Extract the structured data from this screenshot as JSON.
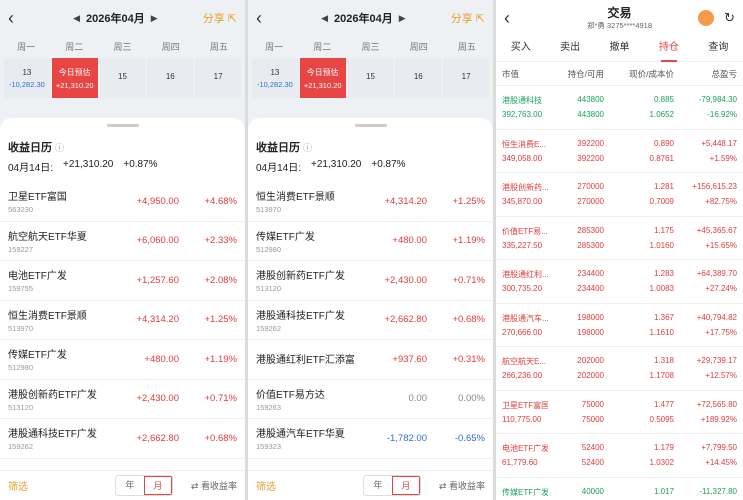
{
  "calendar": {
    "month": "2026年04月",
    "share_label": "分享",
    "weekdays": [
      "周一",
      "周二",
      "周三",
      "周四",
      "周五"
    ],
    "days": [
      {
        "label": "13",
        "pnl": "-10,282.30"
      },
      {
        "label": "今日预估",
        "pnl": "+21,310.20"
      },
      {
        "label": "15",
        "pnl": ""
      },
      {
        "label": "16",
        "pnl": ""
      },
      {
        "label": "17",
        "pnl": ""
      }
    ],
    "section_title": "收益日历",
    "summary_date": "04月14日:",
    "summary_pnl": "+21,310.20",
    "summary_pct": "+0.87%",
    "filter_label": "筛选",
    "segment_year": "年",
    "segment_month": "月",
    "rate_toggle": "看收益率"
  },
  "list_left": [
    {
      "name": "卫星ETF富国",
      "code": "563230",
      "pnl": "+4,950.00",
      "pct": "+4.68%"
    },
    {
      "name": "航空航天ETF华夏",
      "code": "159227",
      "pnl": "+6,060.00",
      "pct": "+2.33%"
    },
    {
      "name": "电池ETF广发",
      "code": "159755",
      "pnl": "+1,257.60",
      "pct": "+2.08%"
    },
    {
      "name": "恒生消费ETF景顺",
      "code": "513970",
      "pnl": "+4,314.20",
      "pct": "+1.25%"
    },
    {
      "name": "传媒ETF广发",
      "code": "512980",
      "pnl": "+480.00",
      "pct": "+1.19%"
    },
    {
      "name": "港股创新药ETF广发",
      "code": "513120",
      "pnl": "+2,430.00",
      "pct": "+0.71%"
    },
    {
      "name": "港股通科技ETF广发",
      "code": "159262",
      "pnl": "+2,662.80",
      "pct": "+0.68%"
    }
  ],
  "list_mid": [
    {
      "name": "恒生消费ETF景顺",
      "code": "513970",
      "pnl": "+4,314.20",
      "pct": "+1.25%",
      "tone": "red"
    },
    {
      "name": "传媒ETF广发",
      "code": "512980",
      "pnl": "+480.00",
      "pct": "+1.19%",
      "tone": "red"
    },
    {
      "name": "港股创新药ETF广发",
      "code": "513120",
      "pnl": "+2,430.00",
      "pct": "+0.71%",
      "tone": "red"
    },
    {
      "name": "港股通科技ETF广发",
      "code": "159262",
      "pnl": "+2,662.80",
      "pct": "+0.68%",
      "tone": "red"
    },
    {
      "name": "港股通红利ETF汇添富",
      "code": "",
      "pnl": "+937.60",
      "pct": "+0.31%",
      "tone": "red"
    },
    {
      "name": "价值ETF易方达",
      "code": "159263",
      "pnl": "0.00",
      "pct": "0.00%",
      "tone": "gray"
    },
    {
      "name": "港股通汽车ETF华夏",
      "code": "159323",
      "pnl": "-1,782.00",
      "pct": "-0.65%",
      "tone": "blue"
    }
  ],
  "trade": {
    "title": "交易",
    "account": "郑*勇 3275****4918",
    "tabs": [
      "买入",
      "卖出",
      "撤单",
      "持仓",
      "查询"
    ],
    "active_tab": 3,
    "headers": [
      "市值",
      "持仓/可用",
      "现价/成本价",
      "总盈亏"
    ],
    "holdings": [
      {
        "name": "港股通科技",
        "mv": "392,763.00",
        "pos": "443800",
        "avail": "443800",
        "price": "0.885",
        "cost": "1.0652",
        "pnl": "-79,984.30",
        "pct": "-16.92%",
        "tone": "green"
      },
      {
        "name": "恒生消费E...",
        "mv": "349,058.00",
        "pos": "392200",
        "avail": "392200",
        "price": "0.890",
        "cost": "0.8761",
        "pnl": "+5,448.17",
        "pct": "+1.59%",
        "tone": "red"
      },
      {
        "name": "港股创新药...",
        "mv": "345,870.00",
        "pos": "270000",
        "avail": "270000",
        "price": "1.281",
        "cost": "0.7009",
        "pnl": "+156,615.23",
        "pct": "+82.75%",
        "tone": "red"
      },
      {
        "name": "价值ETF易...",
        "mv": "335,227.50",
        "pos": "285300",
        "avail": "285300",
        "price": "1.175",
        "cost": "1.0160",
        "pnl": "+45,365.67",
        "pct": "+15.65%",
        "tone": "red"
      },
      {
        "name": "港股通红利...",
        "mv": "300,735.20",
        "pos": "234400",
        "avail": "234400",
        "price": "1.283",
        "cost": "1.0083",
        "pnl": "+64,389.70",
        "pct": "+27.24%",
        "tone": "red"
      },
      {
        "name": "港股通汽车...",
        "mv": "270,666.00",
        "pos": "198000",
        "avail": "198000",
        "price": "1.367",
        "cost": "1.1610",
        "pnl": "+40,794.82",
        "pct": "+17.75%",
        "tone": "red"
      },
      {
        "name": "航空航天E...",
        "mv": "266,236.00",
        "pos": "202000",
        "avail": "202000",
        "price": "1.318",
        "cost": "1.1708",
        "pnl": "+29,739.17",
        "pct": "+12.57%",
        "tone": "red"
      },
      {
        "name": "卫星ETF富国",
        "mv": "110,775.00",
        "pos": "75000",
        "avail": "75000",
        "price": "1.477",
        "cost": "0.5095",
        "pnl": "+72,565.80",
        "pct": "+189.92%",
        "tone": "red"
      },
      {
        "name": "电池ETF广发",
        "mv": "61,779.60",
        "pos": "52400",
        "avail": "52400",
        "price": "1.179",
        "cost": "1.0302",
        "pnl": "+7,799.50",
        "pct": "+14.45%",
        "tone": "red"
      },
      {
        "name": "传媒ETF广发",
        "mv": "40,680.00",
        "pos": "40000",
        "avail": "40000",
        "price": "1.017",
        "cost": "1.3002",
        "pnl": "-11,327.80",
        "pct": "-21.78%",
        "tone": "green"
      }
    ]
  },
  "colors": {
    "red": "#e23b3b",
    "blue": "#2f6fd6",
    "green": "#1aa260",
    "accent": "#e8a030"
  }
}
